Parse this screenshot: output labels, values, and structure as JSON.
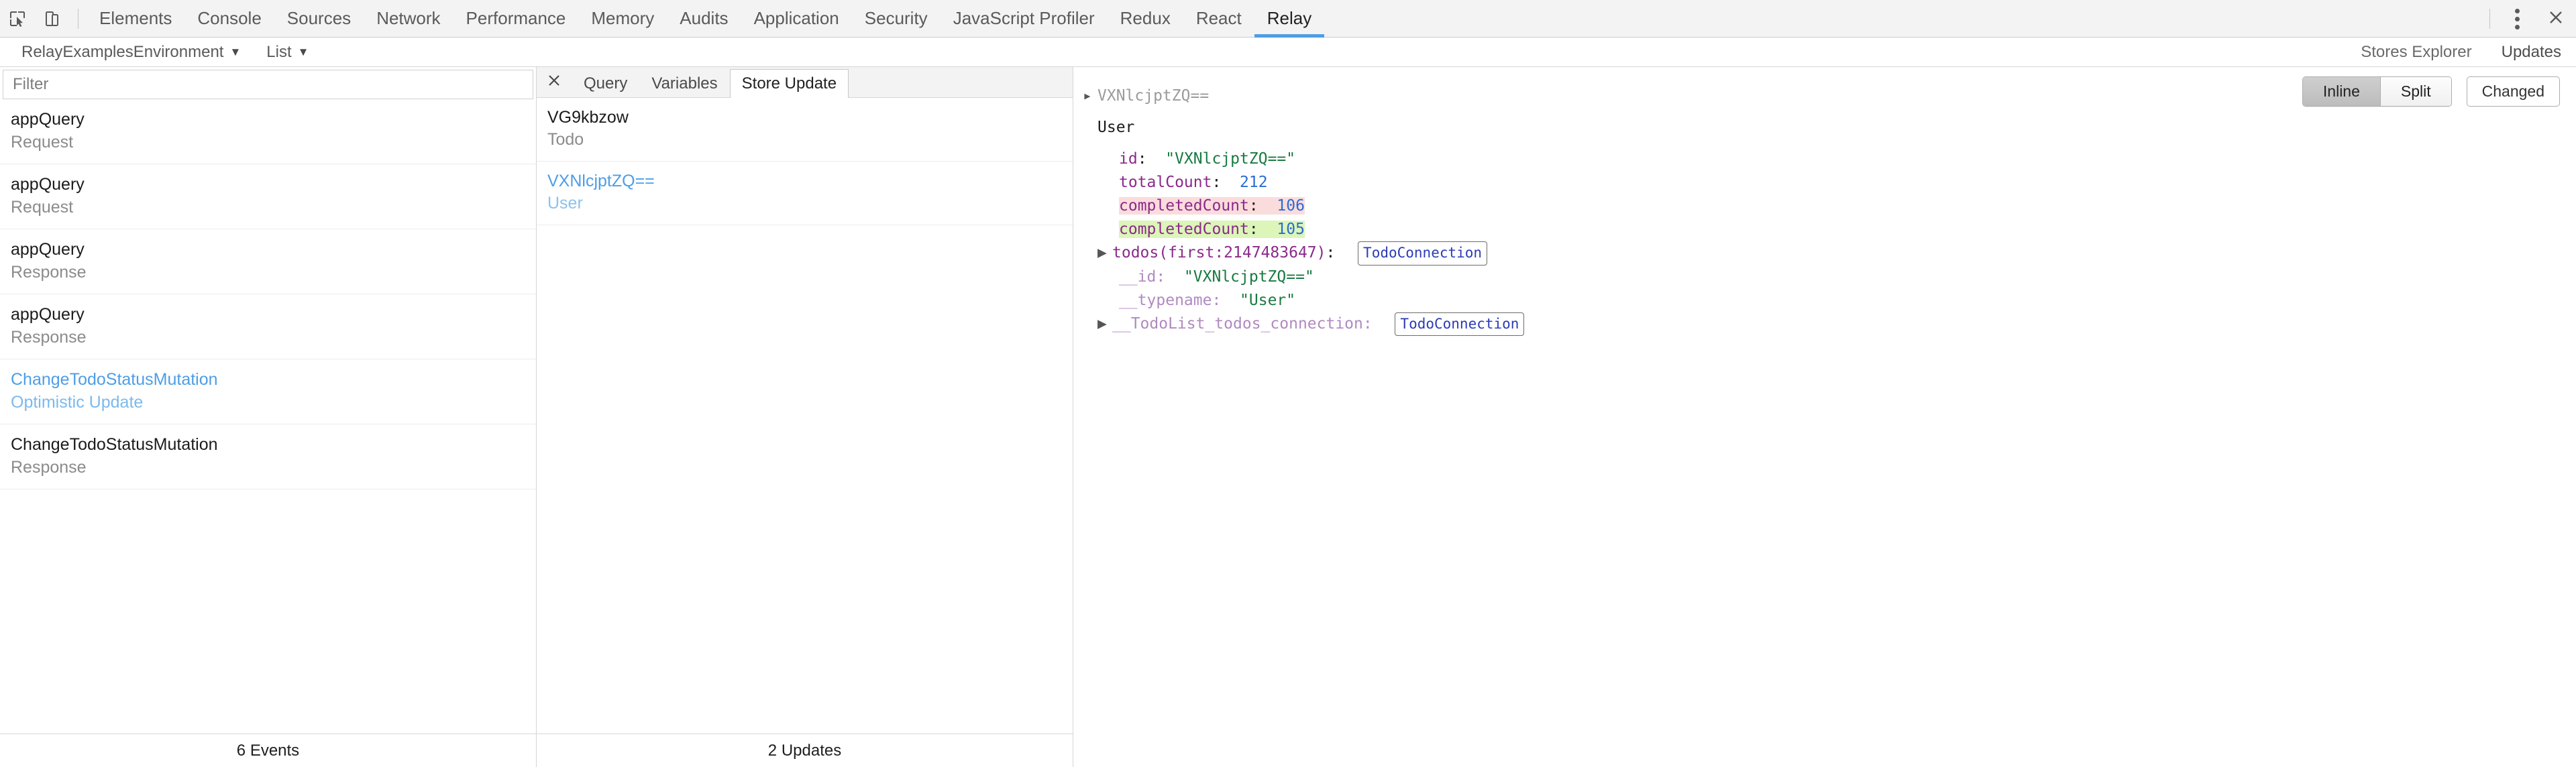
{
  "devtools": {
    "icons": {
      "inspect": "inspect-element-icon",
      "device": "device-toolbar-icon",
      "more": "more-options-icon",
      "close": "close-icon"
    },
    "tabs": [
      {
        "label": "Elements",
        "active": false
      },
      {
        "label": "Console",
        "active": false
      },
      {
        "label": "Sources",
        "active": false
      },
      {
        "label": "Network",
        "active": false
      },
      {
        "label": "Performance",
        "active": false
      },
      {
        "label": "Memory",
        "active": false
      },
      {
        "label": "Audits",
        "active": false
      },
      {
        "label": "Application",
        "active": false
      },
      {
        "label": "Security",
        "active": false
      },
      {
        "label": "JavaScript Profiler",
        "active": false
      },
      {
        "label": "Redux",
        "active": false
      },
      {
        "label": "React",
        "active": false
      },
      {
        "label": "Relay",
        "active": true
      }
    ]
  },
  "relay_bar": {
    "environment_select": "RelayExamplesEnvironment",
    "view_select": "List",
    "caret": "▼",
    "right_tabs": [
      {
        "label": "Stores Explorer",
        "active": false
      },
      {
        "label": "Updates",
        "active": true
      }
    ]
  },
  "events_panel": {
    "filter_placeholder": "Filter",
    "filter_value": "",
    "footer": "6 Events",
    "rows": [
      {
        "title": "appQuery",
        "subtitle": "Request",
        "selected": false
      },
      {
        "title": "appQuery",
        "subtitle": "Request",
        "selected": false
      },
      {
        "title": "appQuery",
        "subtitle": "Response",
        "selected": false
      },
      {
        "title": "appQuery",
        "subtitle": "Response",
        "selected": false
      },
      {
        "title": "ChangeTodoStatusMutation",
        "subtitle": "Optimistic Update",
        "selected": true
      },
      {
        "title": "ChangeTodoStatusMutation",
        "subtitle": "Response",
        "selected": false
      }
    ]
  },
  "updates_panel": {
    "close_icon": "close-icon",
    "tabs": [
      {
        "label": "Query",
        "active": false
      },
      {
        "label": "Variables",
        "active": false
      },
      {
        "label": "Store Update",
        "active": true
      }
    ],
    "footer": "2 Updates",
    "rows": [
      {
        "title": "VG9kbzow",
        "subtitle": "Todo",
        "selected": false
      },
      {
        "title": "VXNlcjptZQ==",
        "subtitle": "User",
        "selected": true
      }
    ]
  },
  "detail_panel": {
    "view_modes": [
      {
        "label": "Inline",
        "active": true
      },
      {
        "label": "Split",
        "active": false
      }
    ],
    "filter_button": "Changed",
    "record_header": "VXNlcjptZQ==",
    "type_header": "User",
    "lines": [
      {
        "indent": 2,
        "arrow": false,
        "key": "id",
        "key_style": "k-key",
        "sep": ":",
        "value": "\"VXNlcjptZQ==\"",
        "value_style": "k-str",
        "chip": null,
        "diff": "none"
      },
      {
        "indent": 2,
        "arrow": false,
        "key": "totalCount",
        "key_style": "k-key",
        "sep": ":",
        "value": "212",
        "value_style": "k-num",
        "chip": null,
        "diff": "none"
      },
      {
        "indent": 2,
        "arrow": false,
        "key": "completedCount",
        "key_style": "k-key",
        "sep": ":",
        "value": "106",
        "value_style": "k-num",
        "chip": null,
        "diff": "removed"
      },
      {
        "indent": 2,
        "arrow": false,
        "key": "completedCount",
        "key_style": "k-key",
        "sep": ":",
        "value": "105",
        "value_style": "k-num",
        "chip": null,
        "diff": "added"
      },
      {
        "indent": 1,
        "arrow": true,
        "key": "todos(first:2147483647)",
        "key_style": "k-key",
        "sep": ":",
        "value": "",
        "value_style": "k-type",
        "chip": "TodoConnection",
        "diff": "none"
      },
      {
        "indent": 2,
        "arrow": false,
        "key": "__id",
        "key_style": "k-key-dim",
        "sep": ":",
        "value": "\"VXNlcjptZQ==\"",
        "value_style": "k-str",
        "chip": null,
        "diff": "none"
      },
      {
        "indent": 2,
        "arrow": false,
        "key": "__typename",
        "key_style": "k-key-dim",
        "sep": ":",
        "value": "\"User\"",
        "value_style": "k-str",
        "chip": null,
        "diff": "none"
      },
      {
        "indent": 1,
        "arrow": true,
        "key": "__TodoList_todos_connection",
        "key_style": "k-key-dim",
        "sep": ":",
        "value": "",
        "value_style": "k-type",
        "chip": "TodoConnection",
        "diff": "none"
      }
    ]
  }
}
